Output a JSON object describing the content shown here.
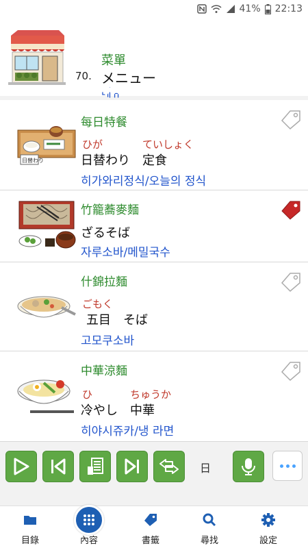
{
  "status": {
    "battery": "41%",
    "time": "22:13"
  },
  "header": {
    "number": "70.",
    "title_zh": "菜單",
    "title_ja": "メニュー",
    "title_ko": "메뉴"
  },
  "items": [
    {
      "zh": "每日特餐",
      "ruby1": "ひが",
      "ruby2": "ていしょく",
      "ja": "日替わり　定食",
      "ko": "히가와리정식/오늘의 정식",
      "tagged": false,
      "img_label": "日替わり"
    },
    {
      "zh": "竹籠蕎麥麵",
      "ruby1": "",
      "ruby2": "",
      "ja": "ざるそば",
      "ko": "자루소바/메밀국수",
      "tagged": true
    },
    {
      "zh": "什錦拉麵",
      "ruby1": "ごもく",
      "ruby2": "",
      "ja": "五目　そば",
      "ko": "고모쿠소바",
      "tagged": false
    },
    {
      "zh": "中華涼麵",
      "ruby1": "ひ",
      "ruby2": "ちゅうか",
      "ja": "冷やし　中華",
      "ko": "히야시쥬카/냉 라면",
      "tagged": false
    }
  ],
  "toolbar": {
    "day_label": "日"
  },
  "nav": [
    {
      "label": "目錄",
      "icon": "folder-icon"
    },
    {
      "label": "內容",
      "icon": "grid-icon"
    },
    {
      "label": "書籤",
      "icon": "bookmark-tag-icon"
    },
    {
      "label": "尋找",
      "icon": "search-icon"
    },
    {
      "label": "設定",
      "icon": "gear-icon"
    }
  ],
  "colors": {
    "green": "#5fa845",
    "blue": "#1e5fb3",
    "tag_red": "#c62828"
  }
}
